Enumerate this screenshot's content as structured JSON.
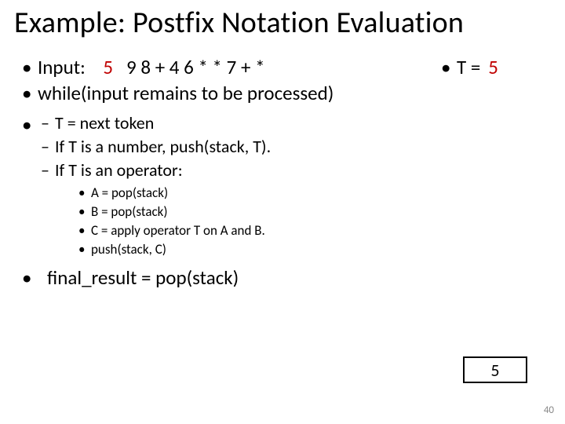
{
  "title": "Example: Postfix Notation Evaluation",
  "input_label": "Input:",
  "input_current": "5",
  "input_rest": "9 8 + 4 6 * * 7 + *",
  "t_label": "T =",
  "t_value": "5",
  "while_line": "while(input remains to be processed)",
  "sub": {
    "a": "T = next token",
    "b": "If T is a number, push(stack, T).",
    "c": "If T is an operator:"
  },
  "inner": {
    "a": "A = pop(stack)",
    "b": "B = pop(stack)",
    "c": "C = apply operator T on A and B.",
    "d": "push(stack, C)"
  },
  "final_line": "final_result = pop(stack)",
  "stack_top": "5",
  "page_number": "40"
}
